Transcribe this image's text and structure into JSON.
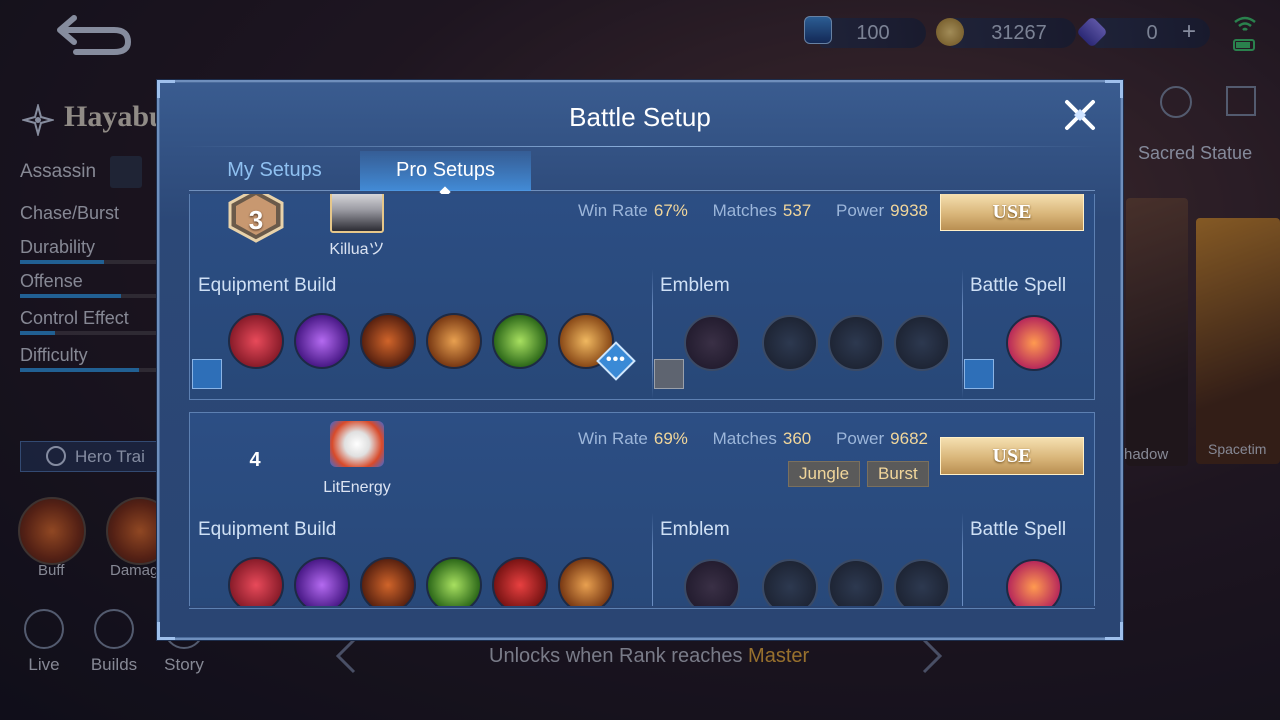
{
  "topbar": {
    "resource_1": "100",
    "resource_2": "31267",
    "resource_3": "0",
    "add_label": "+"
  },
  "hero": {
    "name": "Hayabusa",
    "role": "Assassin",
    "specialty": "Chase/Burst",
    "attributes": [
      {
        "label": "Durability",
        "level": 0.6
      },
      {
        "label": "Offense",
        "level": 0.72
      },
      {
        "label": "Control Effect",
        "level": 0.25
      },
      {
        "label": "Difficulty",
        "level": 0.85
      }
    ],
    "train_label": "Hero Trai",
    "skills": [
      "Buff",
      "Damag"
    ],
    "nav": [
      "Live",
      "Builds",
      "Story"
    ],
    "right_tab": "Sacred Statue",
    "skin_labels": [
      "hadow",
      "Spacetim"
    ]
  },
  "unlock": {
    "prefix": "Unlocks when Rank reaches",
    "rank": "Master"
  },
  "modal": {
    "title": "Battle Setup",
    "tabs": [
      "My Setups",
      "Pro Setups"
    ],
    "active_tab": 1,
    "labels": {
      "win_rate": "Win Rate",
      "matches": "Matches",
      "power": "Power",
      "use": "USE",
      "equipment": "Equipment Build",
      "emblem": "Emblem",
      "spell": "Battle Spell"
    },
    "setups": [
      {
        "rank": "3",
        "player": "Killuaツ",
        "win_rate": "67%",
        "matches": "537",
        "power": "9938",
        "tags": [],
        "items": [
          "#8a1c2a",
          "#6a2aa8",
          "#7a3414",
          "#a3561e",
          "#4a8a2a",
          "#c87a2a"
        ]
      },
      {
        "rank": "4",
        "player": "LitEnergy",
        "win_rate": "69%",
        "matches": "360",
        "power": "9682",
        "tags": [
          "Jungle",
          "Burst"
        ],
        "items": [
          "#8a1c2a",
          "#6a2aa8",
          "#7a3414",
          "#4a8a2a",
          "#9a1e1e",
          "#a3561e"
        ]
      }
    ]
  }
}
